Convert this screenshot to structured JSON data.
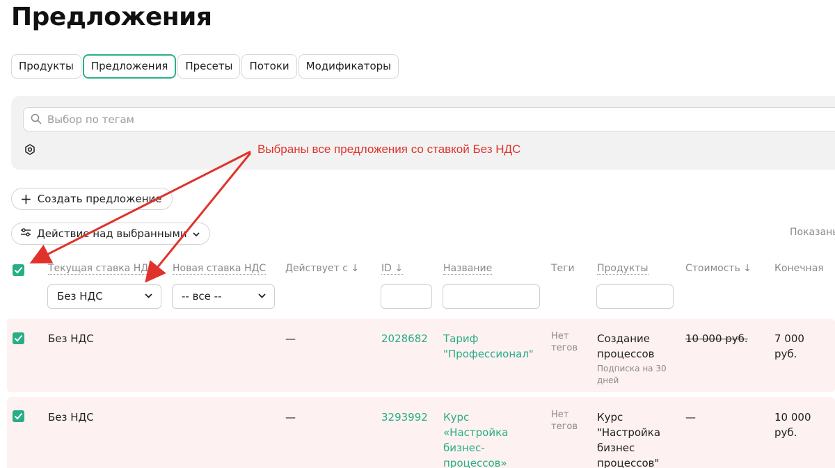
{
  "page": {
    "title": "Предложения"
  },
  "tabs": [
    {
      "label": "Продукты",
      "active": false
    },
    {
      "label": "Предложения",
      "active": true
    },
    {
      "label": "Пресеты",
      "active": false
    },
    {
      "label": "Потоки",
      "active": false
    },
    {
      "label": "Модификаторы",
      "active": false
    }
  ],
  "filters": {
    "tags_placeholder": "Выбор по тегам"
  },
  "annotation": {
    "text": "Выбраны все предложения со ставкой Без НДС",
    "color": "#e0322b"
  },
  "toolbar": {
    "create_label": "Создать предложение",
    "bulk_action_label": "Действие над выбранными",
    "shown_label": "Показаны"
  },
  "table": {
    "headers": {
      "current_vat": "Текущая ставка НДС",
      "new_vat": "Новая ставка НДС",
      "valid_from": "Действует с ↓",
      "id": "ID ↓",
      "name": "Название",
      "tags": "Теги",
      "products": "Продукты",
      "cost": "Стоимость ↓",
      "final": "Конечная"
    },
    "filters": {
      "current_vat": "Без НДС",
      "new_vat": "-- все --"
    },
    "rows": [
      {
        "checked": true,
        "current_vat": "Без НДС",
        "valid_from": "—",
        "id": "2028682",
        "name": "Тариф \"Профессионал\"",
        "tags": "Нет тегов",
        "product": "Создание процессов",
        "product_sub": "Подписка на 30 дней",
        "cost": "10 000 руб.",
        "cost_strikethrough": true,
        "final": "7 000 руб."
      },
      {
        "checked": true,
        "current_vat": "Без НДС",
        "valid_from": "—",
        "id": "3293992",
        "name": "Курс «Настройка бизнес-процессов»",
        "tags": "Нет тегов",
        "product": "Курс \"Настройка бизнес процессов\"",
        "product_sub": "",
        "cost": "—",
        "cost_strikethrough": false,
        "final": "10 000 руб."
      }
    ]
  },
  "colors": {
    "accent": "#27ae85",
    "row_highlight": "#fdf1f1",
    "panel": "#f2f2f2"
  }
}
